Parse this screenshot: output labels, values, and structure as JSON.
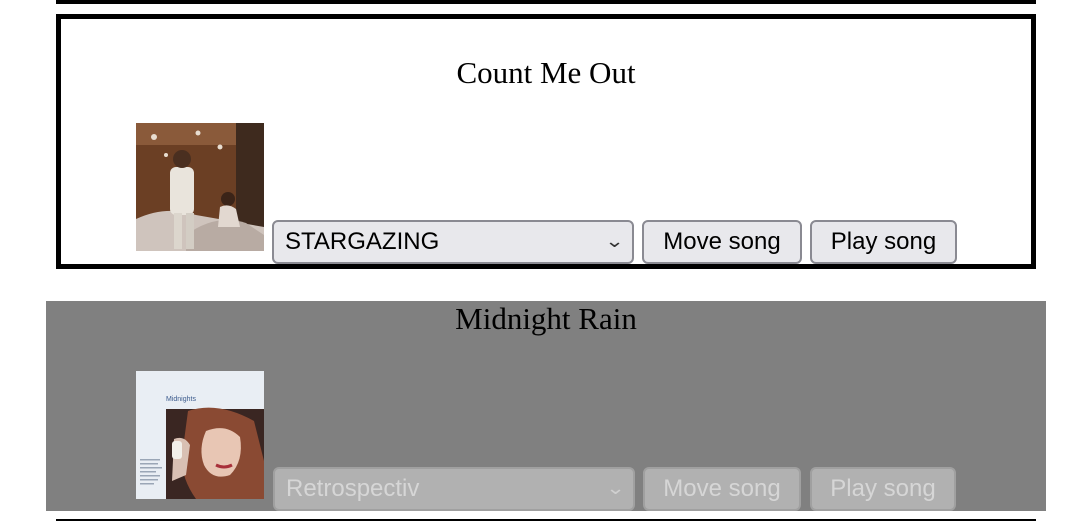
{
  "cards": [
    {
      "title": "Count Me Out",
      "selected_song": "STARGAZING",
      "move_label": "Move song",
      "play_label": "Play song",
      "art_icon": "album-art-photo",
      "state": "active"
    },
    {
      "title": "Midnight Rain",
      "selected_song": "Retrospectiv",
      "move_label": "Move song",
      "play_label": "Play song",
      "art_icon": "album-art-midnights",
      "album_art_text": "Midnights",
      "state": "disabled"
    }
  ],
  "colors": {
    "disabled_background": "#808080",
    "control_background": "#e8e8ec",
    "control_border": "#8a8a92"
  }
}
